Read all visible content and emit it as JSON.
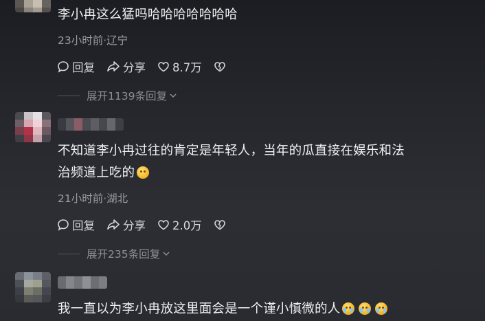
{
  "comments": [
    {
      "text": "李小冉这么猛吗哈哈哈哈哈哈哈",
      "meta": "23小时前·辽宁",
      "reply_label": "回复",
      "share_label": "分享",
      "likes": "8.7万",
      "expand_label": "展开1139条回复"
    },
    {
      "text_line1": "不知道李小冉过往的肯定是年轻人，当年的瓜直接在娱乐和法",
      "text_line2": "治频道上吃的",
      "emoji": "grinning-sweat-emoji",
      "meta": "21小时前·湖北",
      "reply_label": "回复",
      "share_label": "分享",
      "likes": "2.0万",
      "expand_label": "展开235条回复"
    },
    {
      "text": "我一直以为李小冉放这里面会是一个谨小慎微的人",
      "emojis": [
        "crying-laughing-emoji",
        "crying-laughing-emoji",
        "crying-laughing-emoji"
      ]
    }
  ],
  "icons": {
    "reply": "comment-bubble-icon",
    "share": "share-arrow-icon",
    "like": "heart-icon",
    "dislike": "broken-heart-icon",
    "expand": "chevron-down-icon"
  },
  "colors": {
    "background": "#26272d",
    "text": "#f0f0f3",
    "meta": "#9b9ca3",
    "action": "#d7d7db"
  }
}
